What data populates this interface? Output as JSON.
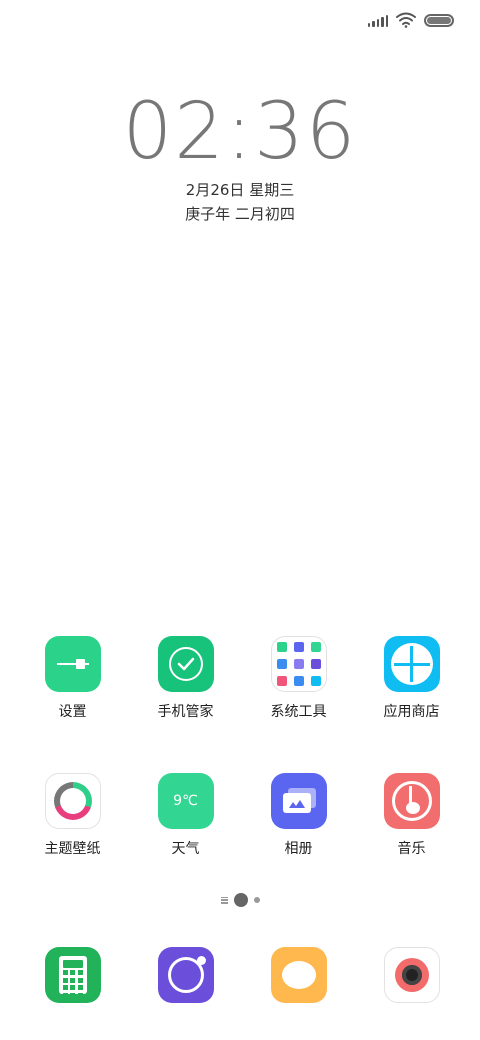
{
  "status_bar": {
    "icons": [
      "signal-icon",
      "wifi-icon",
      "battery-icon"
    ]
  },
  "lock_clock": {
    "time": "02:36",
    "date": "2月26日 星期三",
    "lunar": "庚子年 二月初四"
  },
  "apps": [
    {
      "name": "settings",
      "label": "设置",
      "icon": "settings-icon",
      "color": "#2ad28a"
    },
    {
      "name": "phone-manager",
      "label": "手机管家",
      "icon": "shield-check-icon",
      "color": "#17c27b"
    },
    {
      "name": "system-tools",
      "label": "系统工具",
      "icon": "folder-icon",
      "color": "#ffffff"
    },
    {
      "name": "app-store",
      "label": "应用商店",
      "icon": "store-icon",
      "color": "#0fbdf2"
    },
    {
      "name": "themes",
      "label": "主题壁纸",
      "icon": "theme-icon",
      "color": "#ffffff"
    },
    {
      "name": "weather",
      "label": "天气",
      "icon": "weather-icon",
      "color": "#33d592",
      "icon_text": "9℃"
    },
    {
      "name": "gallery",
      "label": "相册",
      "icon": "gallery-icon",
      "color": "#5a66f0"
    },
    {
      "name": "music",
      "label": "音乐",
      "icon": "music-icon",
      "color": "#f26d6d"
    }
  ],
  "pager": {
    "pages": 2,
    "current_page": 1
  },
  "dock": [
    {
      "name": "calculator",
      "icon": "calculator-icon",
      "color": "#22b25a"
    },
    {
      "name": "browser",
      "icon": "browser-icon",
      "color": "#6b4ed9"
    },
    {
      "name": "messages",
      "icon": "message-icon",
      "color": "#ffb84d"
    },
    {
      "name": "camera",
      "icon": "camera-icon",
      "color": "#f36b6b"
    }
  ]
}
